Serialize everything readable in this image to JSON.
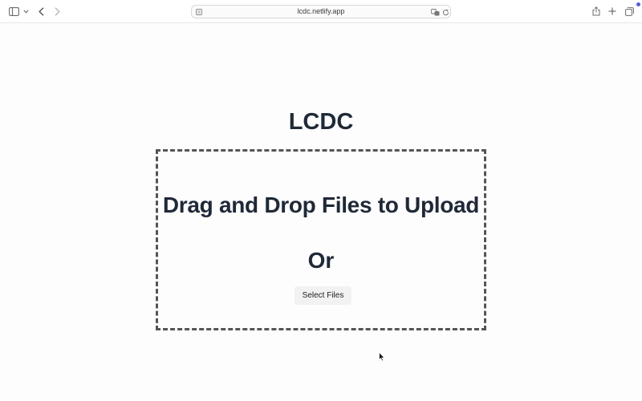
{
  "browser": {
    "url": "lcdc.netlify.app"
  },
  "page": {
    "title": "LCDC",
    "dropzone": {
      "heading": "Drag and Drop Files to Upload",
      "or_text": "Or",
      "select_button_label": "Select Files"
    }
  },
  "icons": {
    "sidebar": "sidebar-toggle-icon",
    "sidebar_chevron": "chevron-down-icon",
    "back": "back-arrow-icon",
    "forward": "forward-arrow-icon",
    "page_menu": "page-menu-icon",
    "translate": "translate-icon",
    "reload": "reload-icon",
    "share": "share-icon",
    "new_tab": "plus-icon",
    "tab_overview": "tab-overview-icon"
  },
  "colors": {
    "heading": "#1f2937",
    "dropzone_border": "#555555",
    "button_bg": "#f2f2f2",
    "notification_dot": "#5b5bd6"
  }
}
